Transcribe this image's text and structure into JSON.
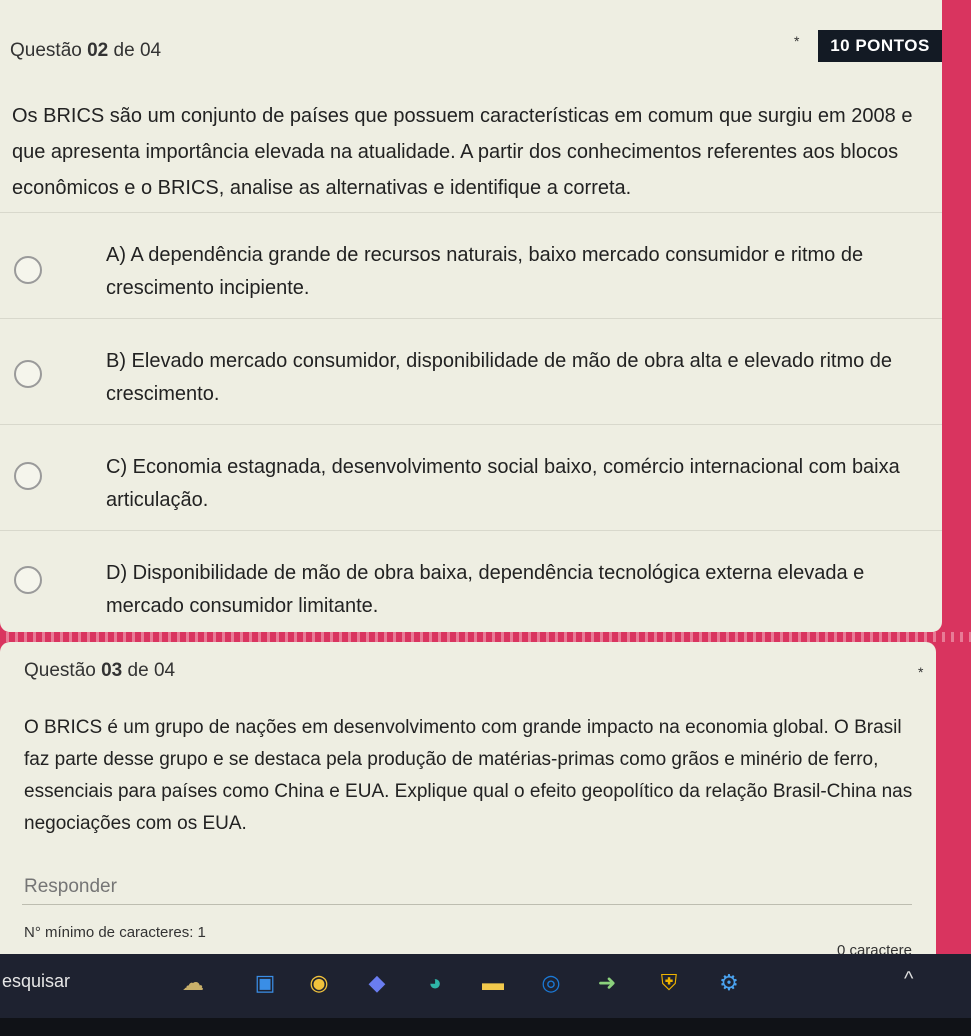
{
  "question2": {
    "label_prefix": "Questão",
    "number": "02",
    "label_suffix": "de 04",
    "required_marker": "*",
    "points": "10 PONTOS",
    "text": "Os BRICS são um conjunto de países que possuem características em comum que surgiu em 2008 e que apresenta importância elevada na atualidade. A partir dos conhecimentos referentes aos blocos econômicos e o BRICS, analise as alternativas e identifique a correta.",
    "options": [
      {
        "label": "A) A dependência grande de recursos naturais, baixo mercado consumidor e ritmo de crescimento incipiente.",
        "selected": false
      },
      {
        "label": "B) Elevado mercado consumidor, disponibilidade de mão de obra alta e elevado ritmo de crescimento.",
        "selected": false
      },
      {
        "label": "C) Economia estagnada, desenvolvimento social baixo, comércio internacional com baixa articulação.",
        "selected": false
      },
      {
        "label": "D) Disponibilidade de mão de obra baixa, dependência tecnológica externa elevada e mercado consumidor limitante.",
        "selected": false
      }
    ]
  },
  "question3": {
    "label_prefix": "Questão",
    "number": "03",
    "label_suffix": "de 04",
    "required_marker": "*",
    "text": "O BRICS é um grupo de nações em desenvolvimento com grande impacto na economia global. O Brasil faz parte desse grupo e se destaca pela produção de matérias-primas como grãos e minério de ferro, essenciais para países como China e EUA. Explique qual o efeito geopolítico da relação Brasil-China nas negociações com os EUA.",
    "answer_placeholder": "Responder",
    "min_chars_label": "N° mínimo de caracteres: 1",
    "char_count": "0 caractere"
  },
  "taskbar": {
    "search_text": "esquisar",
    "icons": [
      "weather-icon",
      "file-explorer-icon",
      "chrome-icon",
      "copilot-icon",
      "edge-icon",
      "folder-icon",
      "outlook-icon",
      "sign-in-icon",
      "security-icon",
      "settings-icon"
    ],
    "tray_chevron": "^"
  },
  "colors": {
    "theme_background": "#d9345f",
    "card_background": "#eeeee2",
    "points_badge": "#131a24",
    "taskbar": "#1e2230"
  }
}
